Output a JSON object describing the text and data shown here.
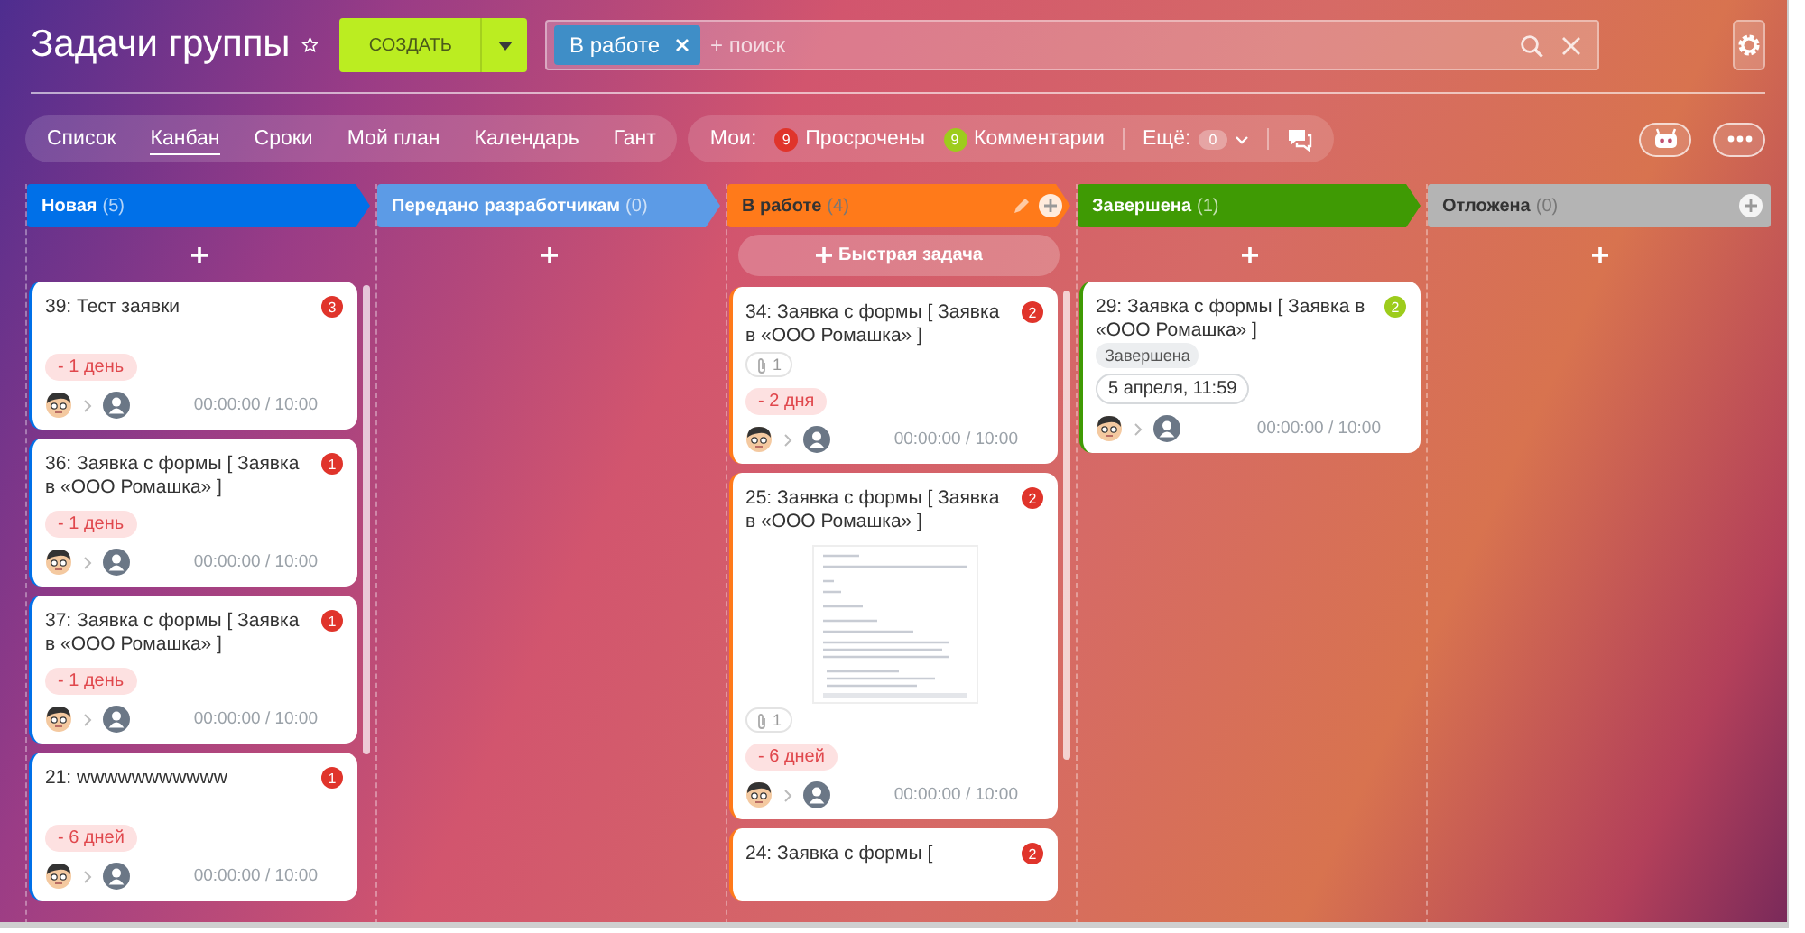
{
  "header": {
    "title": "Задачи группы",
    "create_button": "СОЗДАТЬ",
    "search": {
      "filter_tag": "В работе",
      "placeholder": "+ поиск"
    }
  },
  "view_tabs": [
    {
      "label": "Список",
      "selected": false
    },
    {
      "label": "Канбан",
      "selected": true
    },
    {
      "label": "Сроки",
      "selected": false
    },
    {
      "label": "Мой план",
      "selected": false
    },
    {
      "label": "Календарь",
      "selected": false
    },
    {
      "label": "Гант",
      "selected": false
    }
  ],
  "counters": {
    "label": "Мои:",
    "items": [
      {
        "count": "9",
        "label": "Просрочены",
        "color": "#e0342b"
      },
      {
        "count": "9",
        "label": "Комментарии",
        "color": "#9dcc1c"
      }
    ],
    "more_label": "Ещё:",
    "more_count": "0"
  },
  "columns": [
    {
      "name": "Новая",
      "count": "(5)",
      "color": "#0070e8",
      "edit_icon": false,
      "add_icon": false,
      "scrollbar": true,
      "cards": [
        {
          "title": "39: Тест заявки",
          "count": "3",
          "color": "#e0342b",
          "deadline": "- 1 день",
          "time": "00:00:00 / 10:00"
        },
        {
          "title": "36: Заявка с формы [ Заявка в «ООО Ромашка» ]",
          "count": "1",
          "color": "#e0342b",
          "deadline": "- 1 день",
          "time": "00:00:00 / 10:00"
        },
        {
          "title": "37: Заявка с формы [ Заявка в «ООО Ромашка» ]",
          "count": "1",
          "color": "#e0342b",
          "deadline": "- 1 день",
          "time": "00:00:00 / 10:00"
        },
        {
          "title": "21: wwwwwwwwwww",
          "count": "1",
          "color": "#e0342b",
          "deadline": "- 6 дней",
          "time": "00:00:00 / 10:00"
        }
      ]
    },
    {
      "name": "Передано разработчикам",
      "count": "(0)",
      "color": "#5c9be6",
      "edit_icon": false,
      "add_icon": false,
      "scrollbar": false
    },
    {
      "name": "В работе",
      "count": "(4)",
      "color": "#ff7a1a",
      "edit_icon": true,
      "add_icon": true,
      "quick_task": "Быстрая задача",
      "scrollbar": true,
      "cards": [
        {
          "title": "34: Заявка с формы [ Заявка в «ООО Ромашка» ]",
          "count": "2",
          "color": "#e0342b",
          "attachments": "1",
          "deadline": "- 2 дня",
          "time": "00:00:00 / 10:00"
        },
        {
          "title": "25: Заявка с формы [ Заявка в «ООО Ромашка» ]",
          "count": "2",
          "color": "#e0342b",
          "preview": true,
          "attachments": "1",
          "deadline": "- 6 дней",
          "time": "00:00:00 / 10:00"
        },
        {
          "title": "24: Заявка с формы [",
          "count": "2",
          "color": "#e0342b"
        }
      ]
    },
    {
      "name": "Завершена",
      "count": "(1)",
      "color": "#3f9a04",
      "edit_icon": false,
      "add_icon": false,
      "scrollbar": false,
      "cards": [
        {
          "title": "29: Заявка с формы [ Заявка в «ООО Ромашка» ]",
          "count": "2",
          "color": "#9dcc1c",
          "status": "Завершена",
          "date": "5 апреля, 11:59",
          "time": "00:00:00 / 10:00"
        }
      ]
    },
    {
      "name": "Отложена",
      "count": "(0)",
      "color": "#b4b4b4",
      "edit_icon": false,
      "add_icon": true,
      "scrollbar": false
    }
  ]
}
